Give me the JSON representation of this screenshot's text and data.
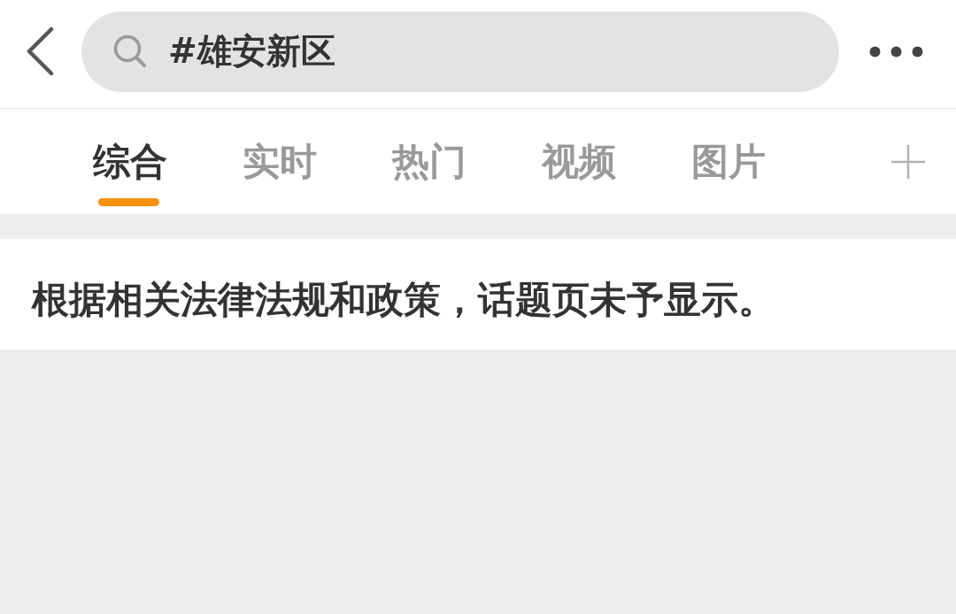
{
  "header": {
    "search": {
      "value": "#雄安新区"
    }
  },
  "tabs": [
    {
      "label": "综合",
      "selected": true
    },
    {
      "label": "实时",
      "selected": false
    },
    {
      "label": "热门",
      "selected": false
    },
    {
      "label": "视频",
      "selected": false
    },
    {
      "label": "图片",
      "selected": false
    }
  ],
  "notice": {
    "text": "根据相关法律法规和政策，话题页未予显示。"
  }
}
